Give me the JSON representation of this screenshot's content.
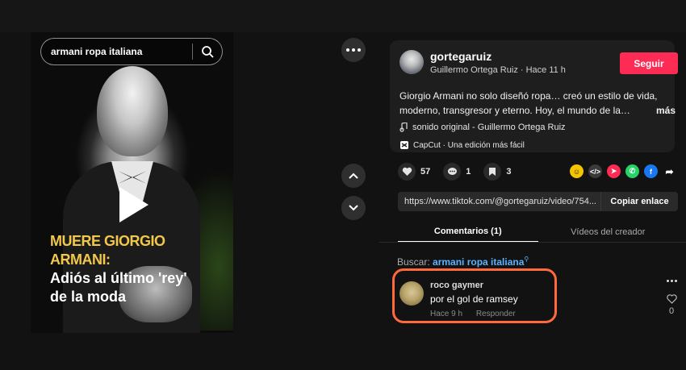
{
  "search": {
    "query": "armani ropa italiana"
  },
  "video": {
    "headline_line1": "MUERE GIORGIO ARMANI:",
    "headline_line2": "Adiós al último 'rey'",
    "headline_line3": "de la moda"
  },
  "post": {
    "username": "gortegaruiz",
    "meta": "Guillermo Ortega Ruiz · Hace 11 h",
    "follow_label": "Seguir",
    "description": "Giorgio Armani no solo diseñó ropa… creó un estilo de vida, moderno, transgresor y eterno. Hoy, el mundo de la…",
    "more_label": "más",
    "sound": "sonido original - Guillermo Ortega Ruiz",
    "capcut": "CapCut · Una edición más fácil"
  },
  "actions": {
    "likes": "57",
    "comments": "1",
    "saves": "3"
  },
  "link": {
    "url": "https://www.tiktok.com/@gortegaruiz/video/754...",
    "copy_label": "Copiar enlace"
  },
  "tabs": [
    {
      "label": "Comentarios (1)"
    },
    {
      "label": "Vídeos del creador"
    }
  ],
  "search_related": {
    "label": "Buscar:",
    "term": "armani ropa italiana"
  },
  "comment": {
    "author": "roco gaymer",
    "text": "por el gol de ramsey",
    "time": "Hace 9 h",
    "reply_label": "Responder",
    "likes": "0"
  },
  "colors": {
    "follow": "#fe2c55",
    "highlight_border": "#ff6a3c",
    "headline_yellow": "#f1c84b",
    "link_blue": "#5db3ff"
  }
}
